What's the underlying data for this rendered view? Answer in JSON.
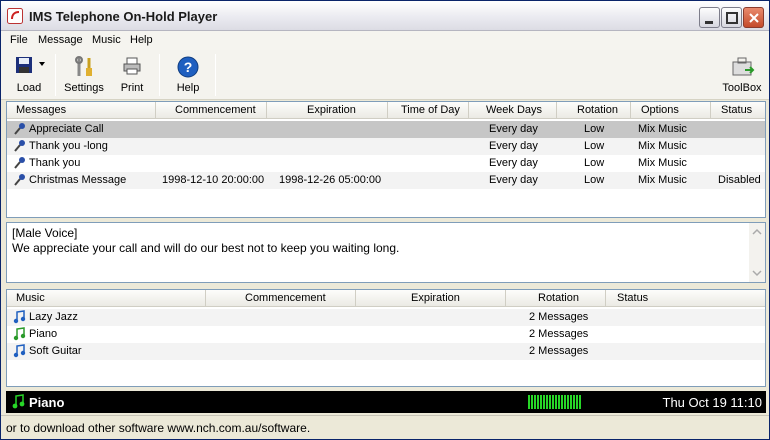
{
  "window": {
    "title": "IMS Telephone On-Hold Player"
  },
  "menu": [
    "File",
    "Message",
    "Music",
    "Help"
  ],
  "toolbar": {
    "load": "Load",
    "settings": "Settings",
    "print": "Print",
    "help": "Help",
    "toolbox": "ToolBox"
  },
  "messages": {
    "headers": [
      "Messages",
      "Commencement",
      "Expiration",
      "Time of Day",
      "Week Days",
      "Rotation",
      "Options",
      "Status"
    ],
    "rows": [
      {
        "name": "Appreciate Call",
        "commencement": "",
        "expiration": "",
        "time_of_day": "",
        "week_days": "Every day",
        "rotation": "Low",
        "options": "Mix Music",
        "status": ""
      },
      {
        "name": "Thank you -long",
        "commencement": "",
        "expiration": "",
        "time_of_day": "",
        "week_days": "Every day",
        "rotation": "Low",
        "options": "Mix Music",
        "status": ""
      },
      {
        "name": "Thank you",
        "commencement": "",
        "expiration": "",
        "time_of_day": "",
        "week_days": "Every day",
        "rotation": "Low",
        "options": "Mix Music",
        "status": ""
      },
      {
        "name": "Christmas Message",
        "commencement": "1998-12-10 20:00:00",
        "expiration": "1998-12-26 05:00:00",
        "time_of_day": "",
        "week_days": "Every day",
        "rotation": "Low",
        "options": "Mix Music",
        "status": "Disabled"
      }
    ]
  },
  "message_text": {
    "line1": "[Male Voice]",
    "line2": "We appreciate your call and will do our best not to keep you waiting long."
  },
  "music": {
    "headers": [
      "Music",
      "Commencement",
      "Expiration",
      "Rotation",
      "Status"
    ],
    "rows": [
      {
        "name": "Lazy Jazz",
        "commencement": "",
        "expiration": "",
        "rotation": "2 Messages",
        "status": ""
      },
      {
        "name": "Piano",
        "commencement": "",
        "expiration": "",
        "rotation": "2 Messages",
        "status": ""
      },
      {
        "name": "Soft Guitar",
        "commencement": "",
        "expiration": "",
        "rotation": "2 Messages",
        "status": ""
      }
    ]
  },
  "now_playing": {
    "title": "Piano",
    "clock": "Thu Oct 19 11:10"
  },
  "status": {
    "text": "or to download other software www.nch.com.au/software."
  },
  "colors": {
    "title_bg": "#e9e9ef",
    "selected_row": "#c6c6c6",
    "playing_bar": "#000000",
    "meter_green": "#27d627"
  }
}
